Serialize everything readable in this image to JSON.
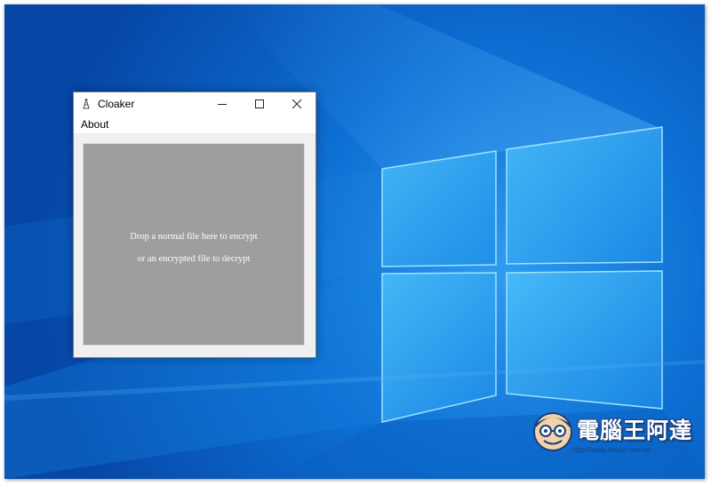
{
  "window": {
    "title": "Cloaker",
    "buttons": {
      "minimize": "minimize",
      "maximize": "maximize",
      "close": "close"
    }
  },
  "menu": {
    "items": [
      {
        "label": "About"
      }
    ]
  },
  "drop_zone": {
    "line1": "Drop a normal file here to encrypt",
    "line2": "or an encrypted file to decrypt"
  },
  "watermark": {
    "title": "電腦王阿達",
    "url": "http://www.kocpc.com.tw"
  },
  "colors": {
    "desktop_blue": "#0a5cc2",
    "drop_zone_gray": "#9e9e9e",
    "window_bg": "#f0f0f0"
  },
  "icons": {
    "app": "cloaker-app-icon",
    "minimize": "minimize-icon",
    "maximize": "maximize-icon",
    "close": "close-icon"
  }
}
